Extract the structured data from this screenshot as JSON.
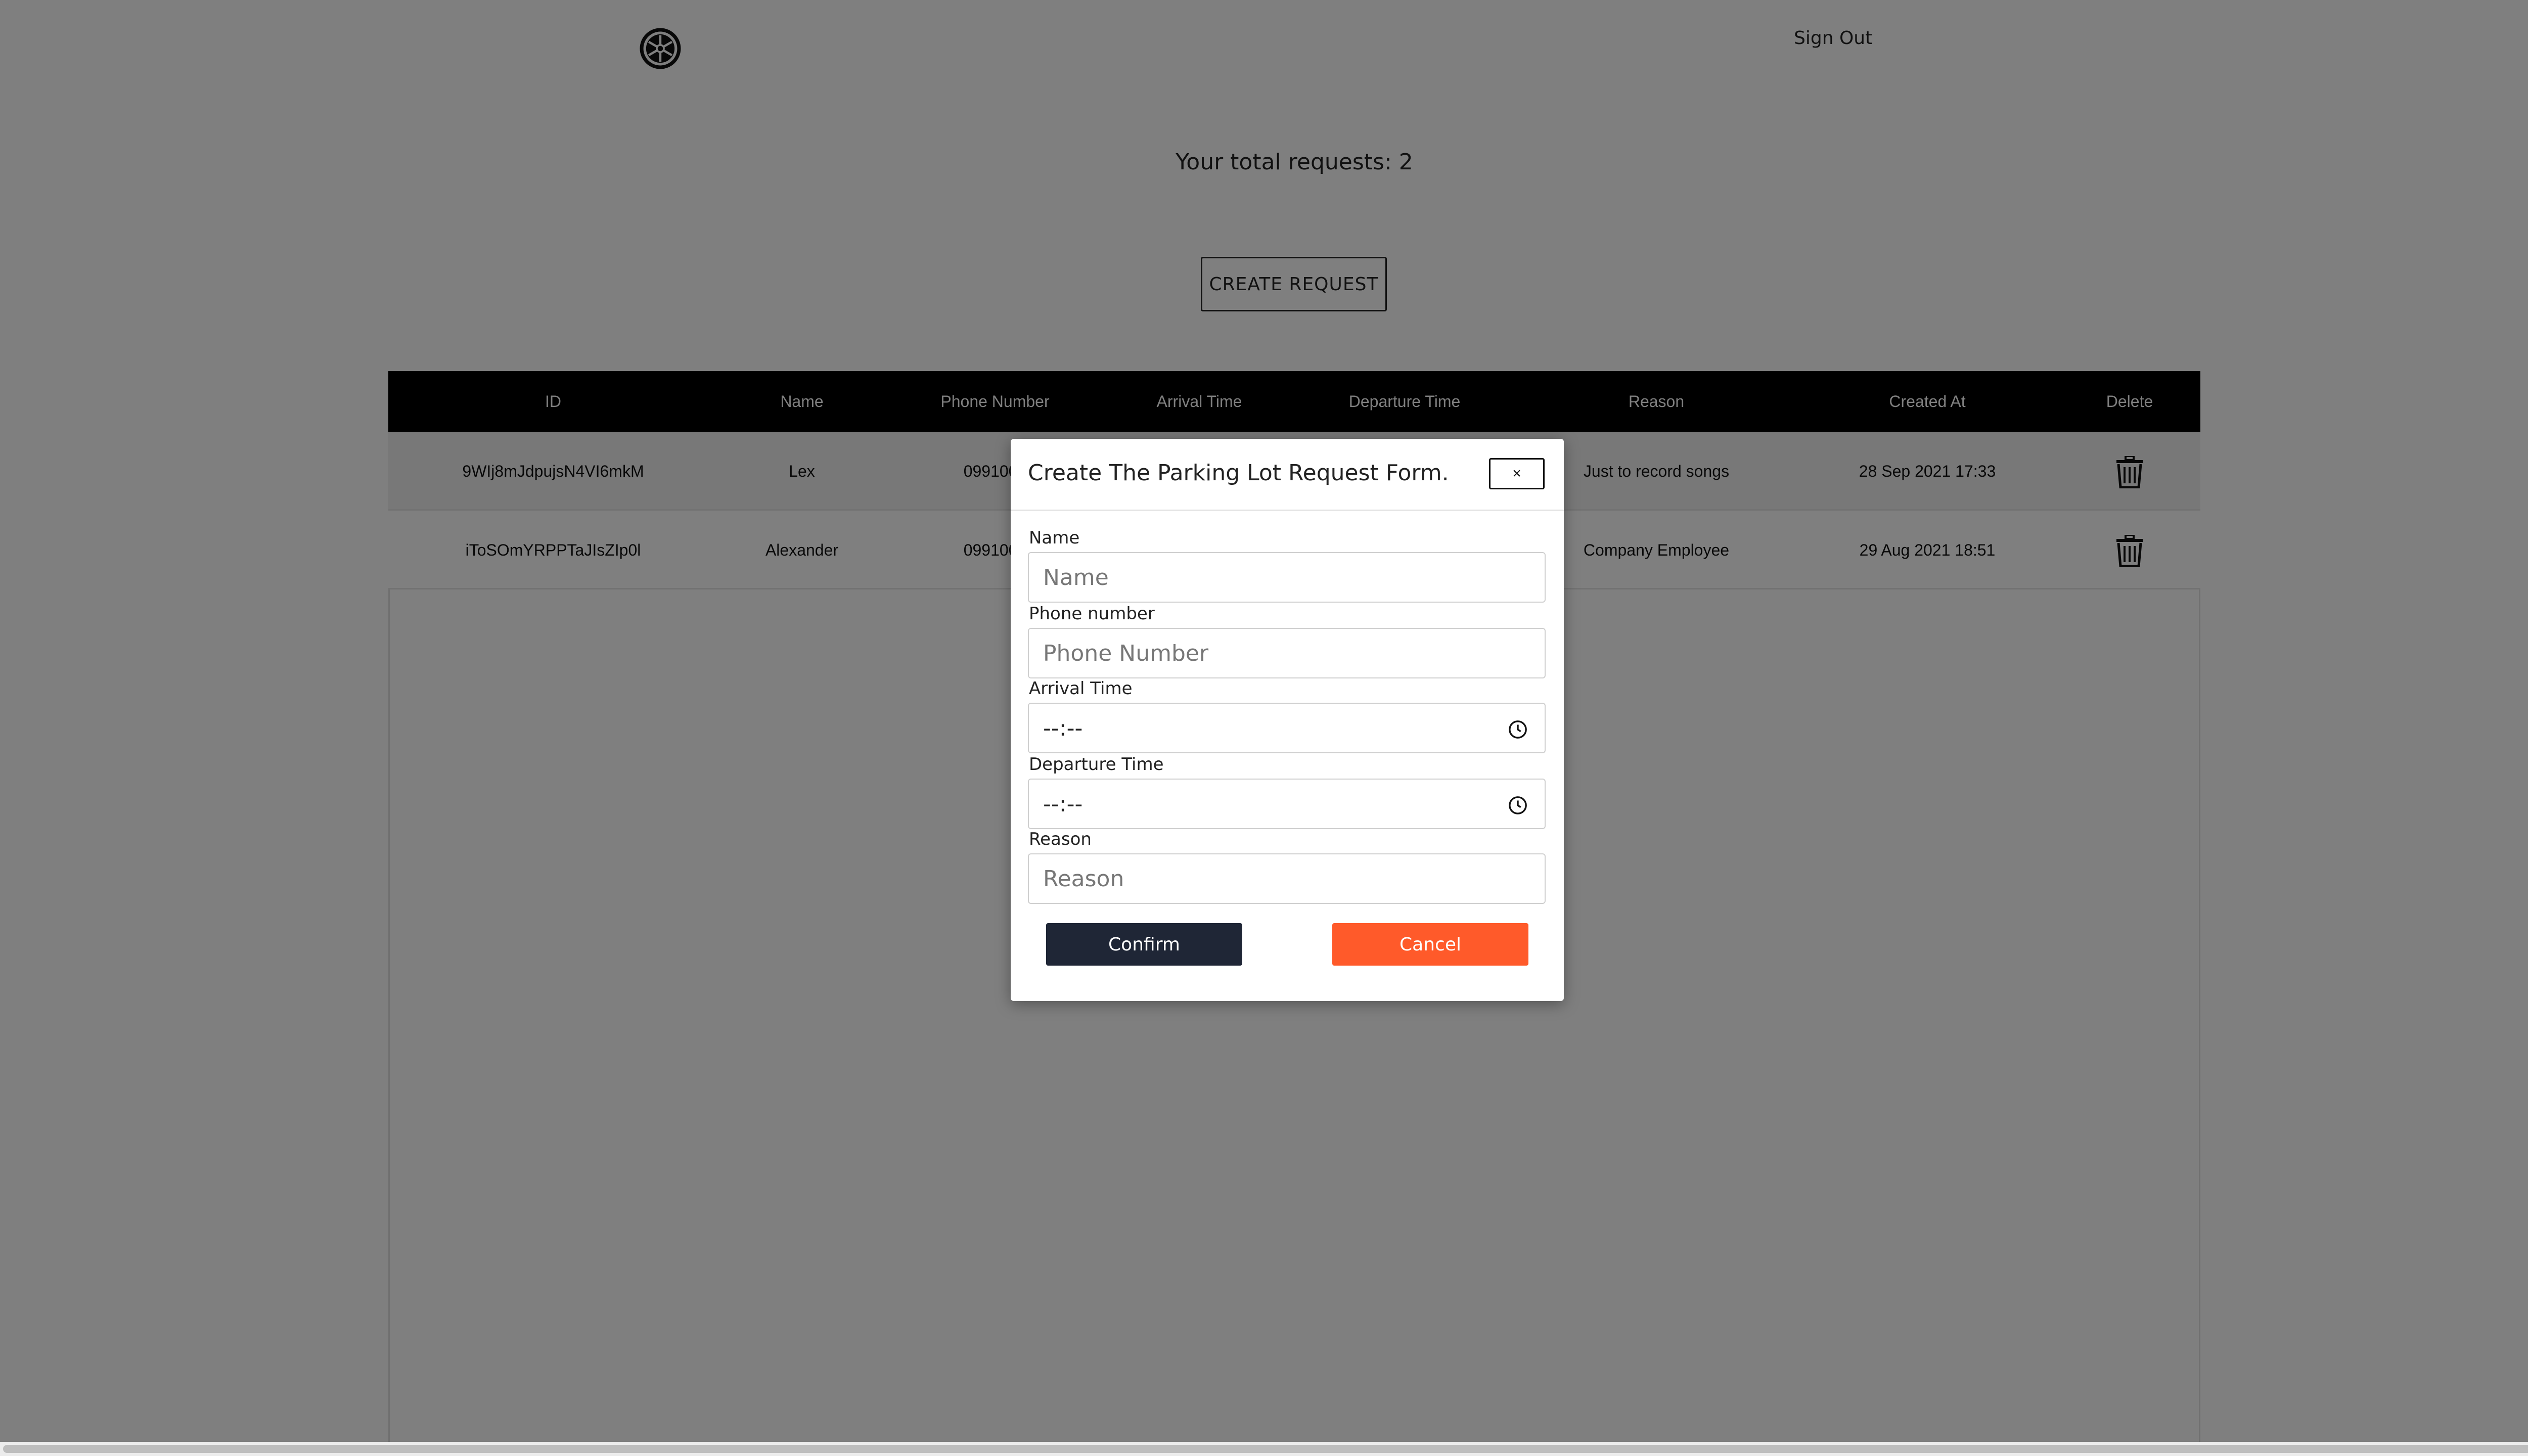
{
  "header": {
    "logo_icon": "imperial-emblem-icon",
    "sign_out_label": "Sign Out"
  },
  "summary": {
    "total_requests_text": "Your total requests: 2"
  },
  "actions": {
    "create_request_label": "CREATE REQUEST"
  },
  "table": {
    "columns": [
      "ID",
      "Name",
      "Phone Number",
      "Arrival Time",
      "Departure Time",
      "Reason",
      "Created At",
      "Delete"
    ],
    "rows": [
      {
        "id": "9WIj8mJdpujsN4VI6mkM",
        "name": "Lex",
        "phone": "0991000",
        "reason": "Just to record songs",
        "created_at": "28 Sep 2021 17:33",
        "delete_icon": "trash-icon"
      },
      {
        "id": "iToSOmYRPPTaJIsZIp0l",
        "name": "Alexander",
        "phone": "0991000",
        "reason": "Company Employee",
        "created_at": "29 Aug 2021 18:51",
        "delete_icon": "trash-icon"
      }
    ]
  },
  "modal": {
    "title": "Create The Parking Lot Request Form.",
    "close_label": "×",
    "fields": {
      "name": {
        "label": "Name",
        "placeholder": "Name",
        "value": ""
      },
      "phone": {
        "label": "Phone number",
        "placeholder": "Phone Number",
        "value": ""
      },
      "arrival": {
        "label": "Arrival Time",
        "value": "--:--",
        "icon": "clock-icon"
      },
      "departure": {
        "label": "Departure Time",
        "value": "--:--",
        "icon": "clock-icon"
      },
      "reason": {
        "label": "Reason",
        "placeholder": "Reason",
        "value": ""
      }
    },
    "confirm_label": "Confirm",
    "cancel_label": "Cancel"
  },
  "colors": {
    "overlay": "#7f7f7f",
    "table_header": "#000000",
    "confirm": "#1f2636",
    "cancel": "#ff5a2a"
  }
}
